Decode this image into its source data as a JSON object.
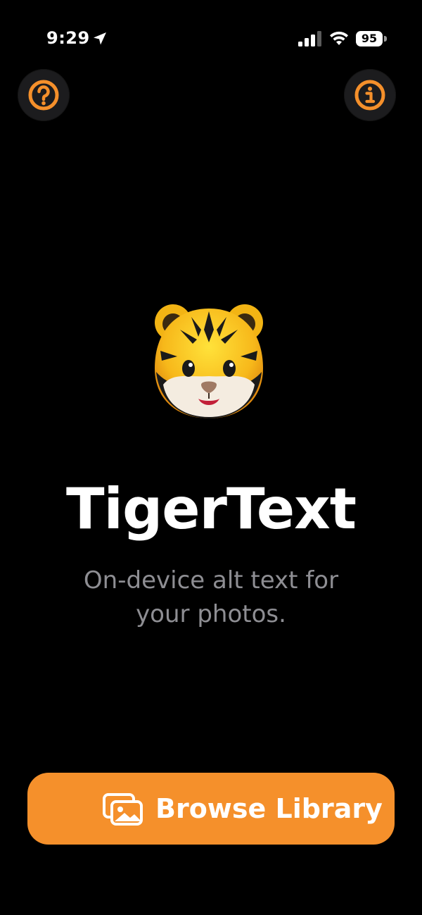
{
  "status_bar": {
    "time": "9:29",
    "battery_level": "95"
  },
  "header": {
    "help_icon": "question-circle-icon",
    "info_icon": "info-circle-icon"
  },
  "hero": {
    "emoji": "tiger-face",
    "title": "TigerText",
    "subtitle": "On-device alt text for your photos."
  },
  "actions": {
    "browse_label": "Browse Library",
    "browse_icon": "photo-stack-icon"
  },
  "colors": {
    "accent": "#f5902b",
    "background": "#000000",
    "subtitle": "#8e8e93",
    "button_bg": "#1c1c1e"
  }
}
